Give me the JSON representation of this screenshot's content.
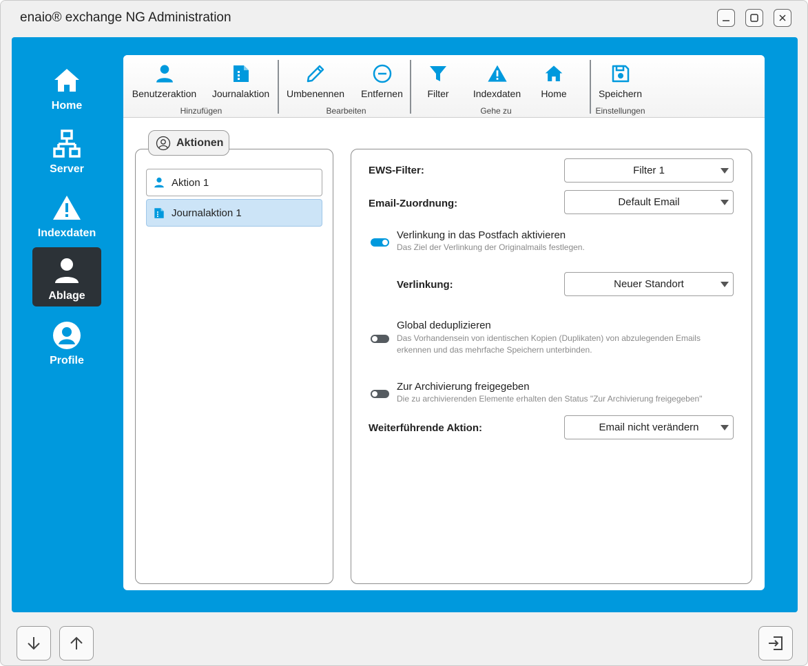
{
  "window": {
    "title": "enaio® exchange NG Administration",
    "controls": [
      "minimize-icon",
      "maximize-icon",
      "close-icon"
    ]
  },
  "colors": {
    "accent": "#0099dd",
    "nav_active": "#2c3237",
    "selected_row": "#cce4f7"
  },
  "sidebar": {
    "items": [
      {
        "label": "Home",
        "icon": "home-icon",
        "active": false
      },
      {
        "label": "Server",
        "icon": "network-icon",
        "active": false
      },
      {
        "label": "Indexdaten",
        "icon": "warning-icon",
        "active": false
      },
      {
        "label": "Ablage",
        "icon": "user-icon",
        "active": true
      },
      {
        "label": "Profile",
        "icon": "profile-icon",
        "active": false
      }
    ]
  },
  "ribbon": {
    "groups": [
      {
        "label": "Hinzufügen",
        "buttons": [
          {
            "label": "Benutzeraktion",
            "icon": "user-icon"
          },
          {
            "label": "Journalaktion",
            "icon": "journal-icon"
          }
        ]
      },
      {
        "label": "Bearbeiten",
        "buttons": [
          {
            "label": "Umbenennen",
            "icon": "pencil-icon"
          },
          {
            "label": "Entfernen",
            "icon": "minus-circle-icon"
          }
        ]
      },
      {
        "label": "Gehe zu",
        "buttons": [
          {
            "label": "Filter",
            "icon": "filter-icon"
          },
          {
            "label": "Indexdaten",
            "icon": "warning-icon"
          },
          {
            "label": "Home",
            "icon": "home-icon"
          }
        ]
      },
      {
        "label": "Einstellungen",
        "buttons": [
          {
            "label": "Speichern",
            "icon": "save-icon"
          }
        ]
      }
    ]
  },
  "actions_panel": {
    "title": "Aktionen",
    "items": [
      {
        "label": "Aktion 1",
        "icon": "user-icon",
        "selected": false
      },
      {
        "label": "Journalaktion 1",
        "icon": "journal-icon",
        "selected": true
      }
    ]
  },
  "details": {
    "ews_filter": {
      "label": "EWS-Filter:",
      "value": "Filter 1"
    },
    "email_mapping": {
      "label": "Email-Zuordnung:",
      "value": "Default Email"
    },
    "link_toggle": {
      "title": "Verlinkung in das Postfach aktivieren",
      "description": "Das Ziel der Verlinkung der Originalmails festlegen.",
      "on": true
    },
    "link_target": {
      "label": "Verlinkung:",
      "value": "Neuer Standort"
    },
    "dedupe_toggle": {
      "title": "Global deduplizieren",
      "description": "Das Vorhandensein von identischen Kopien (Duplikaten) von abzulegenden Emails erkennen und das mehrfache Speichern unterbinden.",
      "on": false
    },
    "archive_toggle": {
      "title": "Zur Archivierung freigegeben",
      "description": "Die zu archivierenden Elemente erhalten den Status \"Zur Archivierung freigegeben\"",
      "on": false
    },
    "further_action": {
      "label": "Weiterführende Aktion:",
      "value": "Email nicht verändern"
    }
  },
  "footer": {
    "buttons": [
      "arrow-down-icon",
      "arrow-up-icon",
      "exit-icon"
    ]
  }
}
